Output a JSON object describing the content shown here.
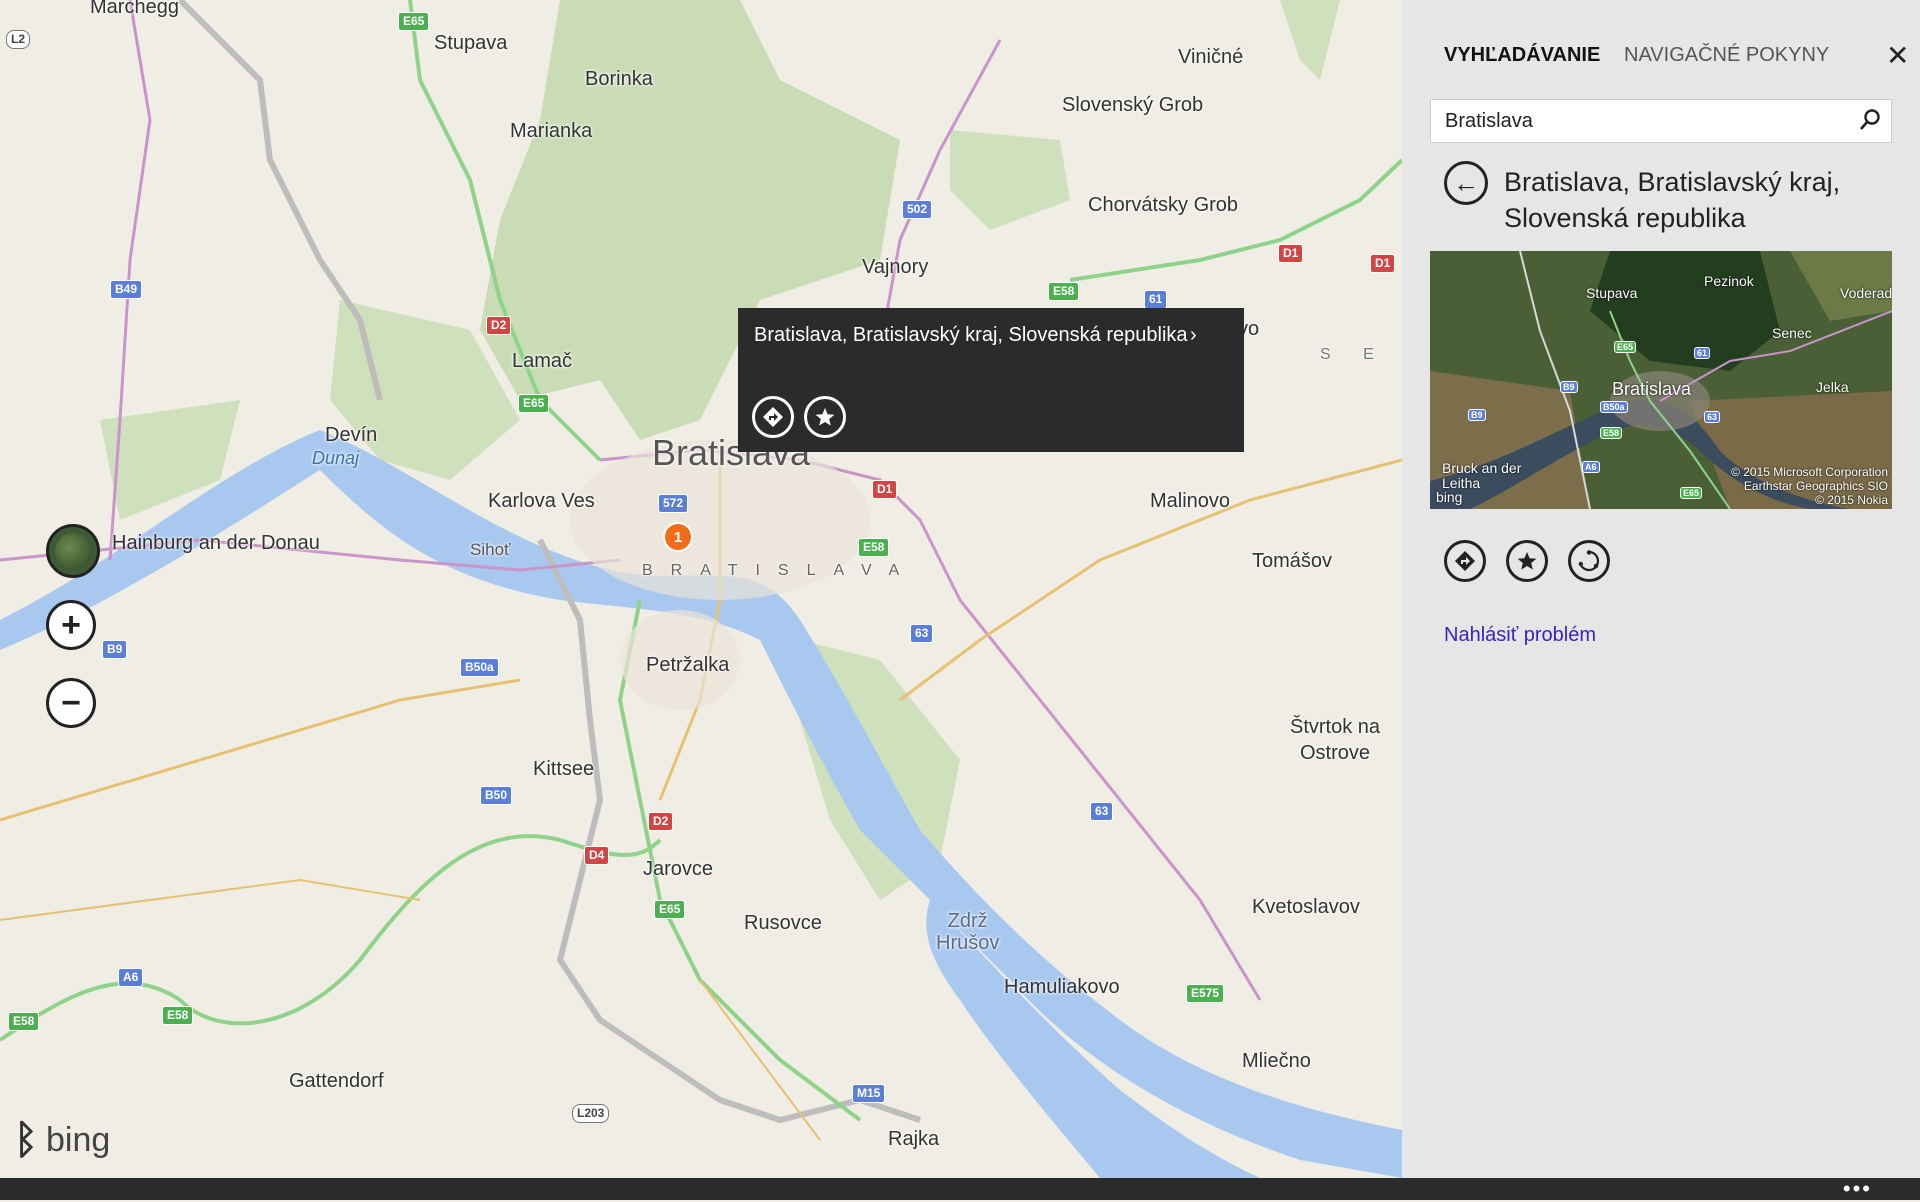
{
  "map": {
    "places": [
      {
        "id": "marchegg",
        "name": "Marchegg"
      },
      {
        "id": "stupava",
        "name": "Stupava"
      },
      {
        "id": "borinka",
        "name": "Borinka"
      },
      {
        "id": "marianka",
        "name": "Marianka"
      },
      {
        "id": "vinicne",
        "name": "Viničné"
      },
      {
        "id": "slovensky-grob",
        "name": "Slovenský Grob"
      },
      {
        "id": "chorvatsky-grob",
        "name": "Chorvátsky Grob"
      },
      {
        "id": "vajnory",
        "name": "Vajnory"
      },
      {
        "id": "lamac",
        "name": "Lamač"
      },
      {
        "id": "devin",
        "name": "Devín"
      },
      {
        "id": "karlova-ves",
        "name": "Karlova Ves"
      },
      {
        "id": "hainburg",
        "name": "Hainburg an der Donau"
      },
      {
        "id": "sihot",
        "name": "Sihoť"
      },
      {
        "id": "malinovo",
        "name": "Malinovo"
      },
      {
        "id": "tomasov",
        "name": "Tomášov"
      },
      {
        "id": "petrzalka",
        "name": "Petržalka"
      },
      {
        "id": "kittsee",
        "name": "Kittsee"
      },
      {
        "id": "stvrtok",
        "name": "Štvrtok na\nOstrove"
      },
      {
        "id": "jarovce",
        "name": "Jarovce"
      },
      {
        "id": "rusovce",
        "name": "Rusovce"
      },
      {
        "id": "zdrz",
        "name": "Zdrž\nHrušov"
      },
      {
        "id": "kvetoslavov",
        "name": "Kvetoslavov"
      },
      {
        "id": "hamuliakovo",
        "name": "Hamuliakovo"
      },
      {
        "id": "gattendorf",
        "name": "Gattendorf"
      },
      {
        "id": "mliecno",
        "name": "Mliečno"
      },
      {
        "id": "rajka",
        "name": "Rajka"
      }
    ],
    "city_label": "Bratislava",
    "district_label": "BRATISLAVA",
    "region_fragment": "S E N",
    "region_fragment_2": "vo",
    "river_label": "Dunaj",
    "shields": [
      "L2",
      "E65",
      "B49",
      "D2",
      "E65",
      "502",
      "E58",
      "61",
      "D1",
      "572",
      "D1",
      "E58",
      "B9",
      "B50a",
      "63",
      "B50",
      "D2",
      "D4",
      "E65",
      "63",
      "A6",
      "E58",
      "E58",
      "E575",
      "M15",
      "L203",
      "D1"
    ],
    "pin_number": "1",
    "zoom_in_label": "+",
    "zoom_out_label": "−",
    "logo_text": "bing"
  },
  "popup": {
    "title": "Bratislava, Bratislavský kraj, Slovenská republika",
    "chevron": "›",
    "directions_icon": "directions-icon",
    "favorite_icon": "favorite-icon"
  },
  "panel": {
    "tabs": [
      {
        "label": "VYHĽADÁVANIE",
        "active": true
      },
      {
        "label": "NAVIGAČNÉ POKYNY",
        "active": false
      }
    ],
    "close_label": "✕",
    "search": {
      "value": "Bratislava",
      "placeholder": ""
    },
    "place_title": "Bratislava, Bratislavský kraj, Slovenská republika",
    "thumbnail": {
      "labels": [
        "Stupava",
        "Pezinok",
        "Voderad",
        "Senec",
        "Bratislava",
        "Jelka",
        "Bruck an der\nLeitha"
      ],
      "shields": [
        "E65",
        "61",
        "B9",
        "B50a",
        "B9",
        "E58",
        "63",
        "A6",
        "E65"
      ],
      "copyright": "© 2015 Microsoft Corporation\nEarthstar Geographics SIO\n© 2015 Nokia",
      "logo_text": "bing"
    },
    "report_link": "Nahlásiť problém"
  },
  "appbar": {
    "more_label": "•••"
  },
  "colors": {
    "accent": "#3b22c4",
    "pin": "#f26d1a",
    "popup_bg": "#2b2b2b",
    "panel_bg": "#e6e6e6"
  }
}
